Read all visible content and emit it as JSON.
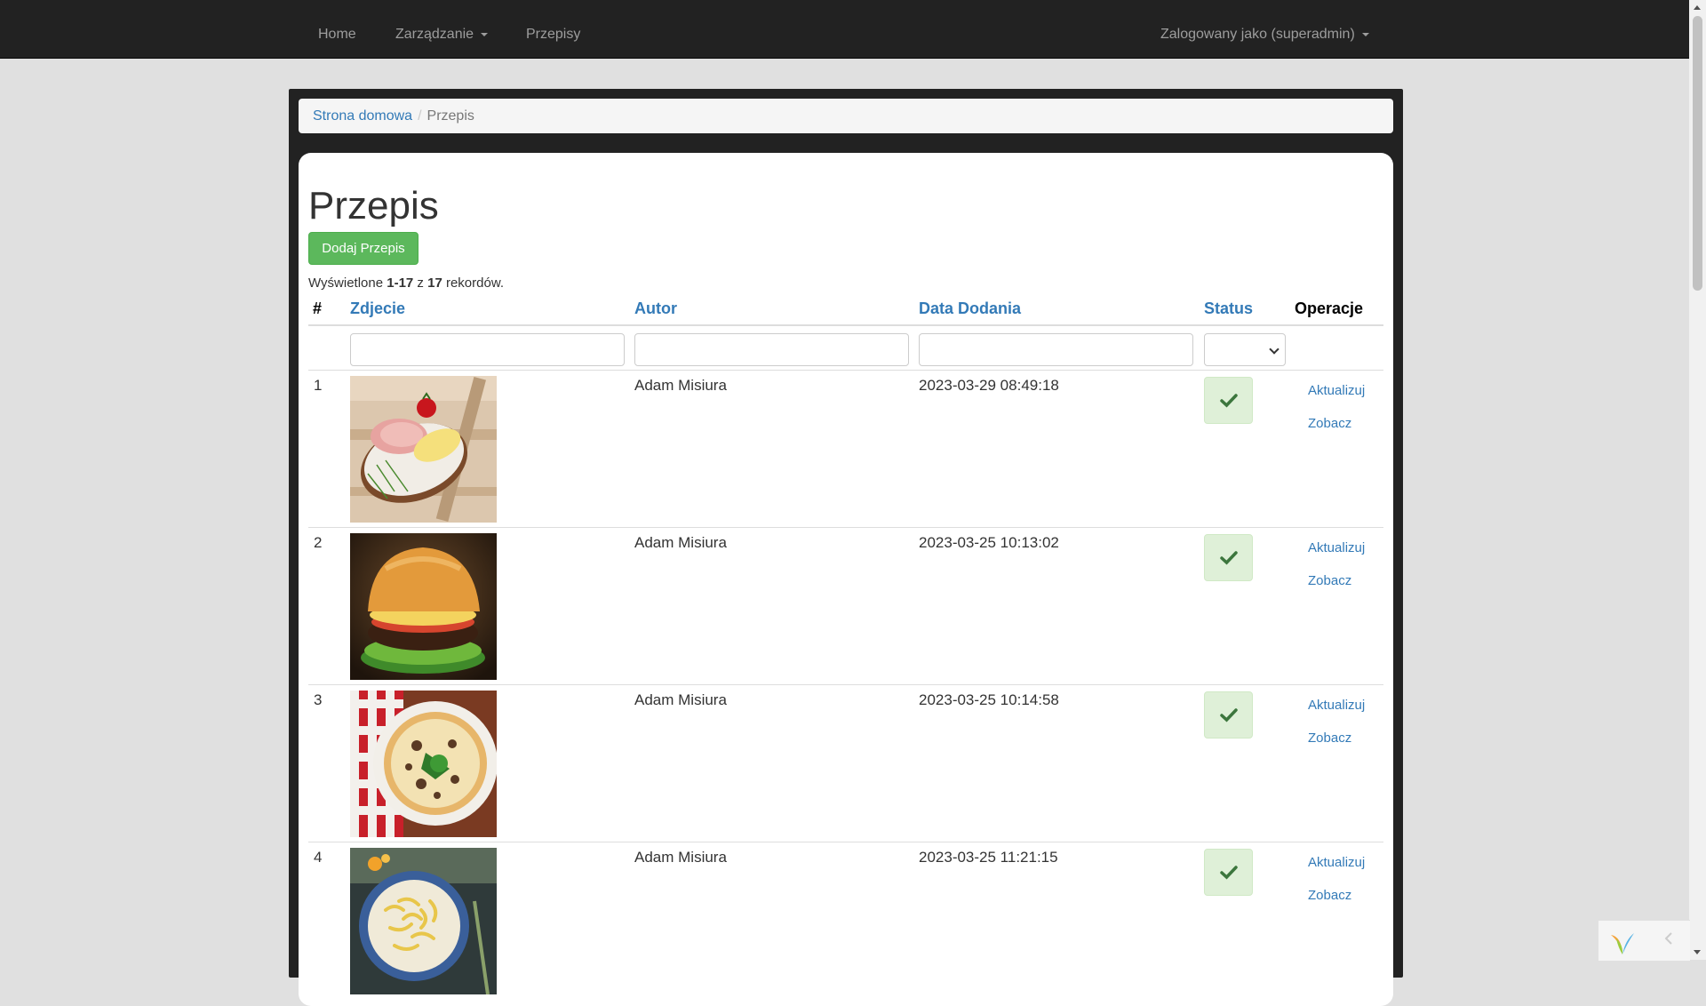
{
  "navbar": {
    "items": [
      {
        "label": "Home"
      },
      {
        "label": "Zarządzanie"
      },
      {
        "label": "Przepisy"
      }
    ],
    "user_label": "Zalogowany jako (superadmin)"
  },
  "breadcrumb": {
    "home": "Strona domowa",
    "separator": "/",
    "current": "Przepis"
  },
  "page": {
    "title": "Przepis",
    "add_button": "Dodaj Przepis",
    "summary": {
      "prefix": "Wyświetlone ",
      "range": "1-17",
      "middle": " z ",
      "total": "17",
      "suffix": " rekordów."
    }
  },
  "table": {
    "headers": {
      "num": "#",
      "photo": "Zdjecie",
      "author": "Autor",
      "date": "Data Dodania",
      "status": "Status",
      "operations": "Operacje"
    },
    "action_update": "Aktualizuj",
    "action_view": "Zobacz",
    "rows": [
      {
        "num": "1",
        "author": "Adam Misiura",
        "date": "2023-03-29 08:49:18",
        "status": "check-icon",
        "photo": "sandwich"
      },
      {
        "num": "2",
        "author": "Adam Misiura",
        "date": "2023-03-25 10:13:02",
        "status": "check-icon",
        "photo": "burger"
      },
      {
        "num": "3",
        "author": "Adam Misiura",
        "date": "2023-03-25 10:14:58",
        "status": "check-icon",
        "photo": "pizza"
      },
      {
        "num": "4",
        "author": "Adam Misiura",
        "date": "2023-03-25 11:21:15",
        "status": "check-icon",
        "photo": "pasta"
      }
    ]
  },
  "colors": {
    "navbar": "#222222",
    "link": "#337ab7",
    "success": "#5cb85c",
    "status_bg": "#dff0d8",
    "check": "#3c763d"
  }
}
